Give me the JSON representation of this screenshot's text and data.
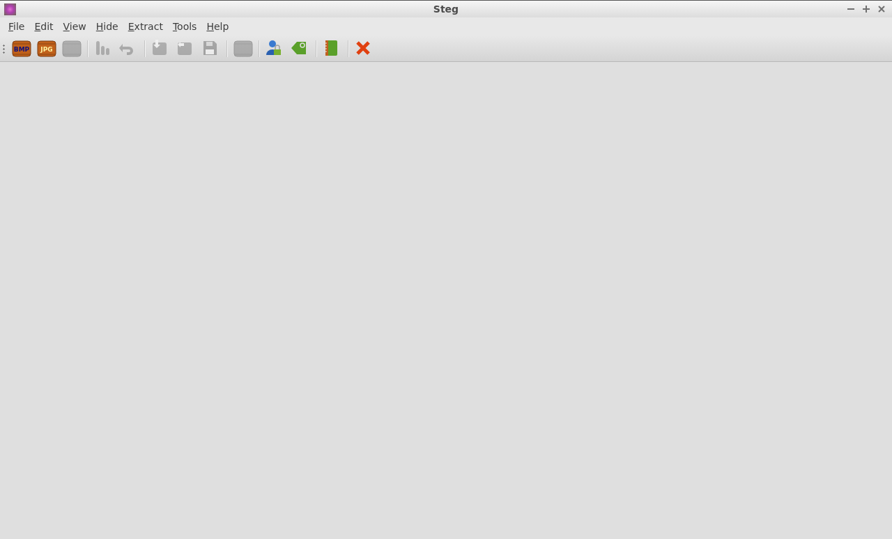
{
  "window": {
    "title": "Steg"
  },
  "menu": [
    {
      "label": "File"
    },
    {
      "label": "Edit"
    },
    {
      "label": "View"
    },
    {
      "label": "Hide"
    },
    {
      "label": "Extract"
    },
    {
      "label": "Tools"
    },
    {
      "label": "Help"
    }
  ],
  "toolbar": [
    {
      "kind": "crate",
      "label": "BMP",
      "disabled": false
    },
    {
      "kind": "crate",
      "label": "JPG",
      "disabled": false
    },
    {
      "kind": "crate",
      "disabled": true
    },
    {
      "kind": "separator"
    },
    {
      "kind": "bars",
      "disabled": true
    },
    {
      "kind": "undo",
      "disabled": true
    },
    {
      "kind": "separator"
    },
    {
      "kind": "import",
      "disabled": true
    },
    {
      "kind": "export",
      "disabled": true
    },
    {
      "kind": "save",
      "disabled": true
    },
    {
      "kind": "separator"
    },
    {
      "kind": "crate",
      "disabled": true
    },
    {
      "kind": "separator"
    },
    {
      "kind": "user-lock",
      "disabled": false
    },
    {
      "kind": "tag",
      "disabled": false
    },
    {
      "kind": "separator"
    },
    {
      "kind": "notebook",
      "disabled": false
    },
    {
      "kind": "separator"
    },
    {
      "kind": "close",
      "disabled": false
    }
  ]
}
